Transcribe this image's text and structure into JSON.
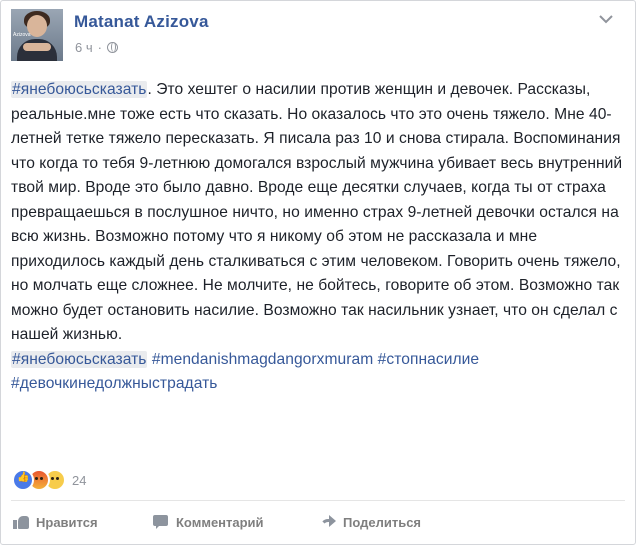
{
  "post": {
    "author": "Matanat Azizova",
    "time": "6 ч",
    "visibility_icon": "globe-icon",
    "menu_icon": "chevron-down-icon",
    "avatar_caption": "Azizova"
  },
  "body": {
    "hashtag_lead": "#янебоюсьсказать",
    "paragraph": ". Это хештег о насилии против женщин и девочек. Рассказы, реальные.мне тоже есть что сказать. Но оказалось что это очень тяжело. Мне 40-летней тетке тяжело пересказать. Я писала раз 10 и снова стирала. Воспоминания что когда то тебя 9-летнюю домогался взрослый мужчина убивает весь внутренний твой мир. Вроде это было давно. Вроде еще десятки случаев, когда ты от страха превращаешься в послушное ничто, но именно страх 9-летней девочки остался на всю жизнь. Возможно потому что я никому об этом не рассказала и мне приходилось каждый день сталкиваться с этим человеком. Говорить очень тяжело, но молчать еще сложнее. Не молчите, не бойтесь, говорите об этом. Возможно так можно будет остановить насилие. Возможно так насильник узнает, что он сделал с нашей жизнью.",
    "hashtags": [
      "#янебоюсьсказать",
      "#mendanishmagdangorxmuram",
      "#стопнасилие",
      "#девочкинедолжныстрадать"
    ]
  },
  "reactions": {
    "icons": [
      "like-reaction-icon",
      "angry-reaction-icon",
      "sad-reaction-icon"
    ],
    "count": "24"
  },
  "actions": {
    "like": "Нравится",
    "comment": "Комментарий",
    "share": "Поделиться"
  },
  "colors": {
    "link": "#365899",
    "text": "#1d2129",
    "meta": "#90949c",
    "action": "#7f7f7f"
  }
}
